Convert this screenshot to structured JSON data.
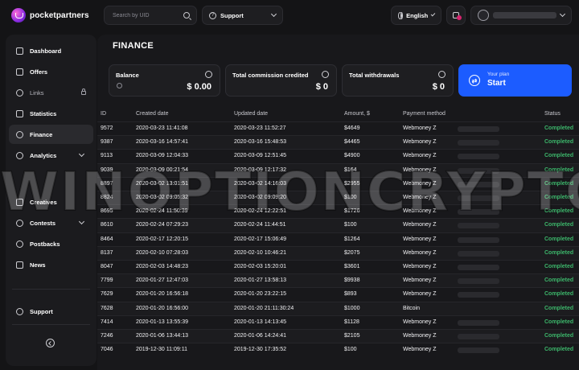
{
  "brand": {
    "name": "pocketpartners"
  },
  "search": {
    "placeholder": "Search by UID"
  },
  "header": {
    "support_label": "Support",
    "language_label": "English"
  },
  "sidebar": {
    "items": [
      {
        "label": "Dashboard",
        "icon": "monitor-icon"
      },
      {
        "label": "Offers",
        "icon": "box-icon"
      },
      {
        "label": "Links",
        "icon": "link-icon",
        "locked": true
      },
      {
        "label": "Statistics",
        "icon": "chart-icon"
      },
      {
        "label": "Finance",
        "icon": "dollar-icon",
        "active": true
      },
      {
        "label": "Analytics",
        "icon": "analytics-icon",
        "expandable": true
      },
      {
        "label": "Creatives",
        "icon": "image-icon"
      },
      {
        "label": "Contests",
        "icon": "trophy-icon",
        "expandable": true
      },
      {
        "label": "Postbacks",
        "icon": "postback-icon"
      },
      {
        "label": "News",
        "icon": "news-icon"
      },
      {
        "label": "Support",
        "icon": "help-icon"
      }
    ]
  },
  "page": {
    "title": "FINANCE"
  },
  "cards": {
    "balance": {
      "title": "Balance",
      "value": "$ 0.00"
    },
    "commission": {
      "title": "Total commission credited",
      "value": "$ 0"
    },
    "withdrawals": {
      "title": "Total withdrawals",
      "value": "$ 0"
    },
    "plan": {
      "small": "Your plan",
      "big": "Start"
    }
  },
  "table": {
    "headers": [
      "ID",
      "Created date",
      "Updated date",
      "Amount, $",
      "Payment method",
      "Status"
    ],
    "rows": [
      [
        "9572",
        "2020-03-23 11:41:08",
        "2020-03-23 11:52:27",
        "$4649",
        "Webmoney Z",
        "Completed"
      ],
      [
        "9387",
        "2020-03-16 14:57:41",
        "2020-03-16 15:48:53",
        "$4465",
        "Webmoney Z",
        "Completed"
      ],
      [
        "9113",
        "2020-03-09 12:04:33",
        "2020-03-09 12:51:45",
        "$4900",
        "Webmoney Z",
        "Completed"
      ],
      [
        "9039",
        "2020-03-09 00:21:54",
        "2020-03-09 12:17:32",
        "$164",
        "Webmoney Z",
        "Completed"
      ],
      [
        "8897",
        "2020-03-02 13:01:51",
        "2020-03-02 14:16:03",
        "$2955",
        "Webmoney Z",
        "Completed"
      ],
      [
        "8824",
        "2020-03-02 09:05:32",
        "2020-03-02 09:09:20",
        "$100",
        "Webmoney Z",
        "Completed"
      ],
      [
        "8695",
        "2020-02-24 11:50:39",
        "2020-02-24 12:22:51",
        "$1726",
        "Webmoney Z",
        "Completed"
      ],
      [
        "8610",
        "2020-02-24 07:29:23",
        "2020-02-24 11:44:51",
        "$100",
        "Webmoney Z",
        "Completed"
      ],
      [
        "8464",
        "2020-02-17 12:20:15",
        "2020-02-17 15:06:49",
        "$1264",
        "Webmoney Z",
        "Completed"
      ],
      [
        "8137",
        "2020-02-10 07:28:03",
        "2020-02-10 10:46:21",
        "$2075",
        "Webmoney Z",
        "Completed"
      ],
      [
        "8047",
        "2020-02-03 14:48:23",
        "2020-02-03 15:20:01",
        "$3601",
        "Webmoney Z",
        "Completed"
      ],
      [
        "7799",
        "2020-01-27 12:47:03",
        "2020-01-27 13:58:13",
        "$9938",
        "Webmoney Z",
        "Completed"
      ],
      [
        "7629",
        "2020-01-20 16:56:18",
        "2020-01-20 23:22:15",
        "$893",
        "Webmoney Z",
        "Completed"
      ],
      [
        "7628",
        "2020-01-20 16:56:00",
        "2020-01-20 21:11:30:24",
        "$1000",
        "Bitcoin",
        "Completed"
      ],
      [
        "7414",
        "2020-01-13 13:55:39",
        "2020-01-13 14:13:45",
        "$1128",
        "Webmoney Z",
        "Completed"
      ],
      [
        "7246",
        "2020-01-06 13:44:13",
        "2020-01-06 14:24:41",
        "$2105",
        "Webmoney Z",
        "Completed"
      ],
      [
        "7046",
        "2019-12-30 11:09:11",
        "2019-12-30 17:35:52",
        "$100",
        "Webmoney Z",
        "Completed"
      ]
    ]
  },
  "watermark": "WINOPTIONCRYPTO.COM",
  "colors": {
    "accent": "#1c5cff",
    "status_completed": "#3cb56a",
    "brand_pink": "#d6246e"
  }
}
